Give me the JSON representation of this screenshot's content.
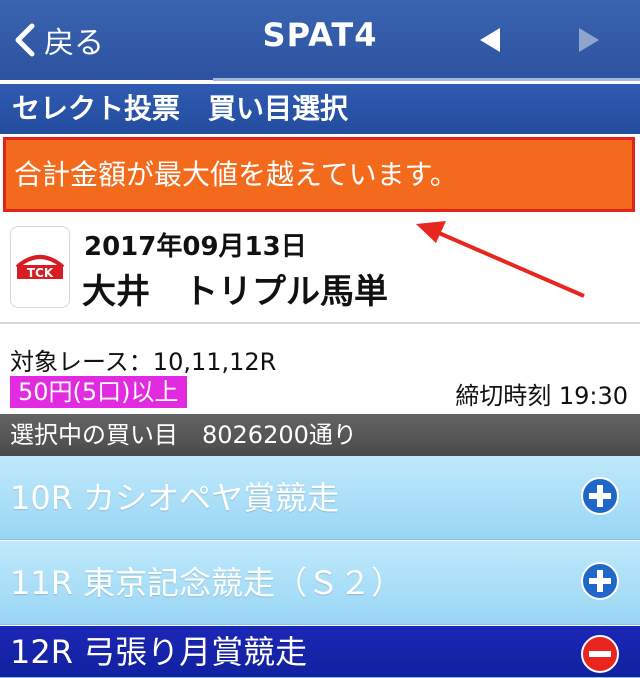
{
  "nav": {
    "back_label": "戻る",
    "title": "SPAT4"
  },
  "section_header": "セレクト投票　買い目選択",
  "error_message": "合計金額が最大値を越えています。",
  "race": {
    "logo_text": "TCK",
    "date": "2017年09月13日",
    "name": "大井　トリプル馬単"
  },
  "target": {
    "races": "対象レース：10,11,12R",
    "min_bet": "50円(5口)以上",
    "deadline": "締切時刻 19:30"
  },
  "selected_header": "選択中の買い目　8026200通り",
  "races": [
    {
      "label": "10R カシオペヤ賞競走",
      "state": "collapsed"
    },
    {
      "label": "11R 東京記念競走（Ｓ２）",
      "state": "collapsed"
    },
    {
      "label": "12R 弓張り月賞競走",
      "state": "expanded"
    }
  ],
  "colors": {
    "nav": "#2c52a0",
    "error": "#f46a1c",
    "badge": "#e22be0",
    "row": "#a9dcf6",
    "row_active": "#1622aa"
  }
}
